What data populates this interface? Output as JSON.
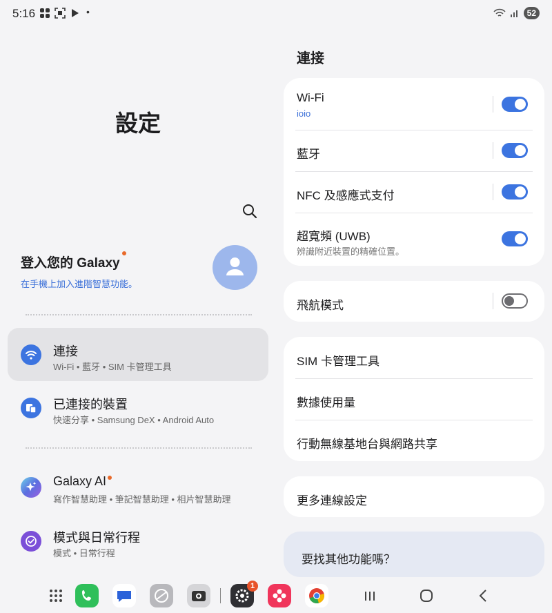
{
  "status_bar": {
    "time": "5:16",
    "battery": "52"
  },
  "left": {
    "title": "設定",
    "account": {
      "name": "登入您的 Galaxy",
      "subtitle": "在手機上加入進階智慧功能。"
    },
    "menu": [
      {
        "title": "連接",
        "subtitle": "Wi-Fi • 藍牙 • SIM 卡管理工具",
        "icon": "wifi-icon",
        "color": "#3c74e0"
      },
      {
        "title": "已連接的裝置",
        "subtitle": "快速分享 • Samsung DeX • Android Auto",
        "icon": "devices-icon",
        "color": "#3c74e0"
      },
      {
        "title": "Galaxy AI",
        "subtitle": "寫作智慧助理 • 筆記智慧助理 • 相片智慧助理",
        "icon": "sparkle-icon",
        "color": "#5b6ee0"
      },
      {
        "title": "模式與日常行程",
        "subtitle": "模式 • 日常行程",
        "icon": "modes-icon",
        "color": "#7b4fd8"
      }
    ]
  },
  "right": {
    "heading": "連接",
    "group1": [
      {
        "title": "Wi-Fi",
        "subtitle": "ioio",
        "toggle": "on"
      },
      {
        "title": "藍牙",
        "toggle": "on"
      },
      {
        "title": "NFC 及感應式支付",
        "toggle": "on"
      },
      {
        "title": "超寬頻 (UWB)",
        "subtitle": "辨識附近裝置的精確位置。",
        "toggle": "on"
      }
    ],
    "airplane": {
      "title": "飛航模式",
      "toggle": "off"
    },
    "group3": [
      "SIM 卡管理工具",
      "數據使用量",
      "行動無線基地台與網路共享"
    ],
    "more": "更多連線設定",
    "find": "要找其他功能嗎？"
  },
  "taskbar": {
    "settings_badge": "1",
    "apps": [
      "app-drawer-icon",
      "phone-app-icon",
      "messages-app-icon",
      "internet-app-icon",
      "camera-app-icon",
      "settings-app-icon",
      "gallery-app-icon",
      "chrome-app-icon"
    ]
  },
  "colors": {
    "accent": "#3c74e0",
    "orange_dot": "#e8692a",
    "toggle_off": "#6c6c70"
  }
}
